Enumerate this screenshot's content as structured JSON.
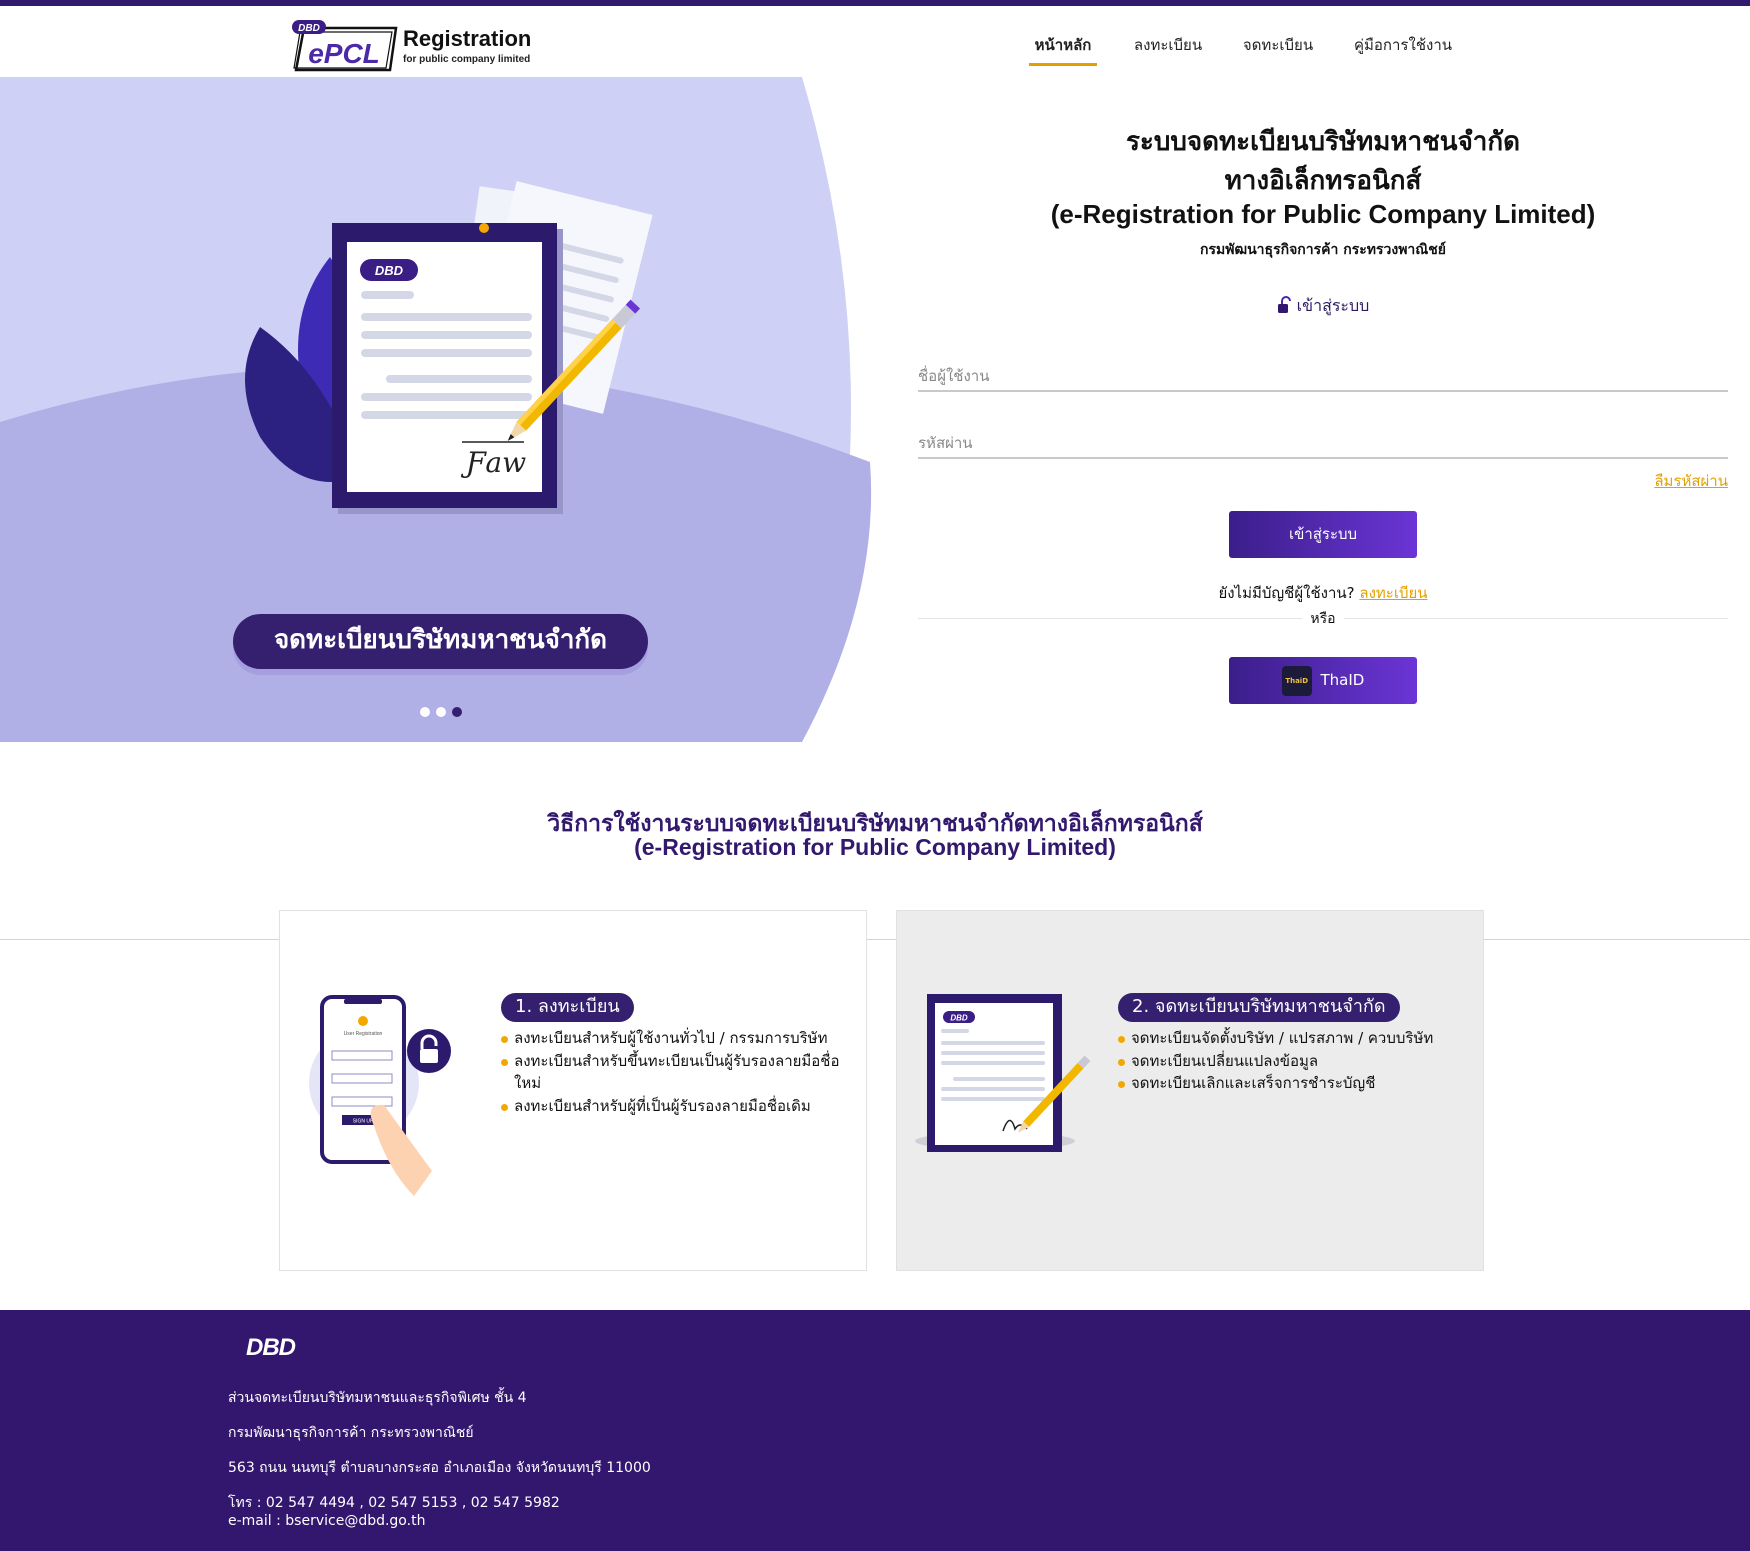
{
  "brand": {
    "badge": "DBD",
    "name": "ePCL",
    "title": "Registration",
    "subtitle": "for public company limited"
  },
  "nav": {
    "items": [
      {
        "label": "หน้าหลัก",
        "active": true
      },
      {
        "label": "ลงทะเบียน",
        "active": false
      },
      {
        "label": "จดทะเบียน",
        "active": false
      },
      {
        "label": "คู่มือการใช้งาน",
        "active": false
      }
    ]
  },
  "hero": {
    "caption": "จดทะเบียนบริษัทมหาชนจำกัด",
    "doc_badge": "DBD",
    "signature": "Ƒaw",
    "slides_total": 3,
    "active_slide": 3
  },
  "login": {
    "title_line1": "ระบบจดทะเบียนบริษัทมหาชนจำกัด",
    "title_line2": "ทางอิเล็กทรอนิกส์",
    "title_line3": "(e-Registration for Public Company Limited)",
    "agency": "กรมพัฒนาธุรกิจการค้า กระทรวงพาณิชย์",
    "heading": "เข้าสู่ระบบ",
    "username_placeholder": "ชื่อผู้ใช้งาน",
    "password_placeholder": "รหัสผ่าน",
    "forgot_label": "ลืมรหัสผ่าน",
    "submit_label": "เข้าสู่ระบบ",
    "no_account_text": "ยังไม่มีบัญชีผู้ใช้งาน?",
    "register_label": "ลงทะเบียน",
    "or_text": "หรือ",
    "thaid_logo_text": "ThaiD",
    "thaid_label": "ThaID"
  },
  "howto": {
    "title_line1": "วิธีการใช้งานระบบจดทะเบียนบริษัทมหาชนจำกัดทางอิเล็กทรอนิกส์",
    "title_line2": "(e-Registration for Public Company Limited)",
    "cards": [
      {
        "label": "1. ลงทะเบียน",
        "phone_header": "User Registration",
        "phone_button": "SIGN UP",
        "items": [
          "ลงทะเบียนสำหรับผู้ใช้งานทั่วไป / กรรมการบริษัท",
          "ลงทะเบียนสำหรับขึ้นทะเบียนเป็นผู้รับรองลายมือชื่อใหม่",
          "ลงทะเบียนสำหรับผู้ที่เป็นผู้รับรองลายมือชื่อเดิม"
        ]
      },
      {
        "label": "2. จดทะเบียนบริษัทมหาชนจำกัด",
        "doc_badge": "DBD",
        "items": [
          "จดทะเบียนจัดตั้งบริษัท / แปรสภาพ / ควบบริษัท",
          "จดทะเบียนเปลี่ยนแปลงข้อมูล",
          "จดทะเบียนเลิกและเสร็จการชำระบัญชี"
        ]
      }
    ]
  },
  "footer": {
    "logo": "DBD",
    "line1": "ส่วนจดทะเบียนบริษัทมหาชนและธุรกิจพิเศษ ชั้น 4",
    "line2": "กรมพัฒนาธุรกิจการค้า กระทรวงพาณิชย์",
    "line3": "563 ถนน นนทบุรี ตำบลบางกระสอ อำเภอเมือง จังหวัดนนทบุรี 11000",
    "line4": "โทร : 02 547 4494 , 02 547 5153 , 02 547 5982",
    "line5": "e-mail : bservice@dbd.go.th"
  },
  "colors": {
    "brand_purple": "#33176f",
    "accent_yellow": "#e3a100",
    "button_gradient_start": "#3b1e8a",
    "button_gradient_end": "#6b35d6",
    "hero_light": "#cfd0f5",
    "hero_mid": "#b0b0e6"
  },
  "icons": {
    "login_heading": "lock-icon",
    "thaid_button": "thaid-logo-icon"
  }
}
